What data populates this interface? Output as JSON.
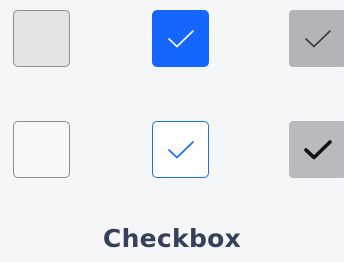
{
  "caption": "Checkbox",
  "checkboxes": [
    {
      "state": "unchecked-disabled",
      "icon": "none"
    },
    {
      "state": "checked-focused",
      "icon": "check-icon"
    },
    {
      "state": "checked-disabled",
      "icon": "check-icon"
    },
    {
      "state": "unchecked-default",
      "icon": "none"
    },
    {
      "state": "checked-outline",
      "icon": "check-icon"
    },
    {
      "state": "checked-muted",
      "icon": "check-icon"
    }
  ],
  "colors": {
    "background": "#f5f6f8",
    "accent": "#1565ff",
    "accent_outline": "#1f6fff",
    "disabled_fill": "#e3e4e6",
    "muted_fill": "#b3b4b7",
    "border": "#8d8f93",
    "caption": "#35405a"
  }
}
